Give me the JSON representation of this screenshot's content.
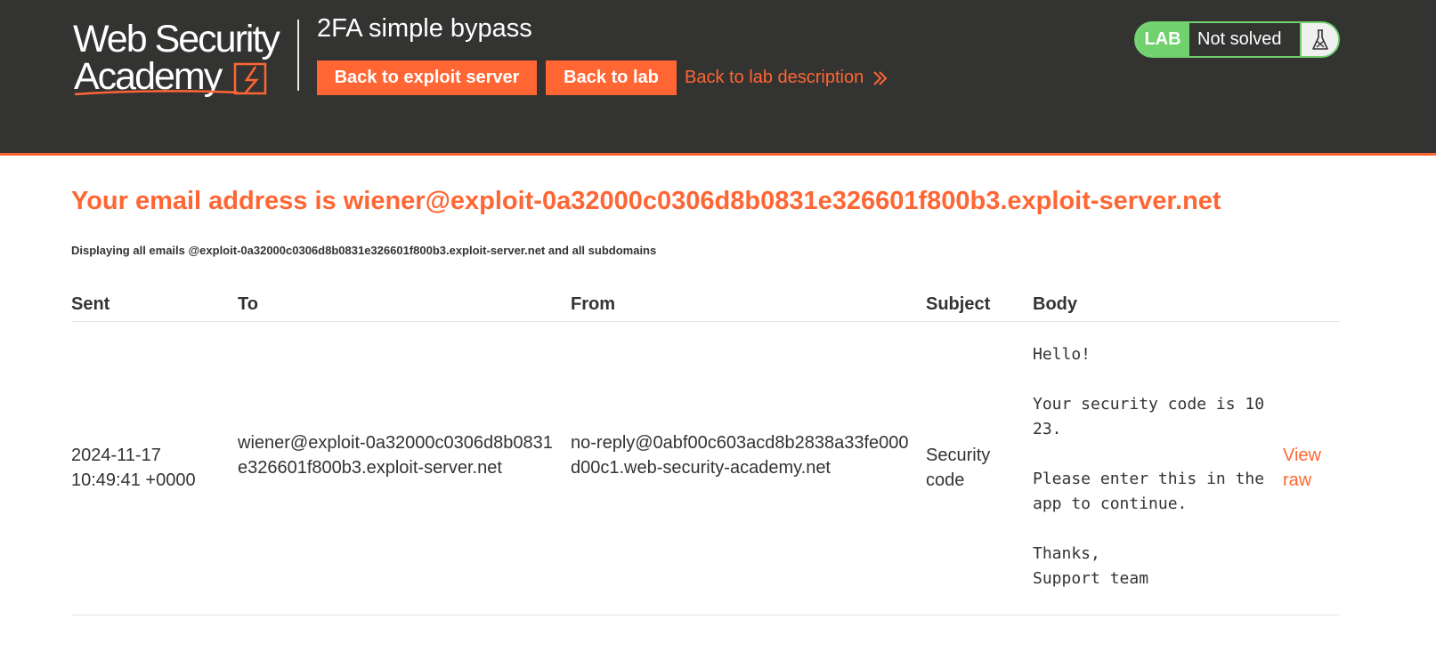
{
  "header": {
    "logo_line1": "Web Security",
    "logo_line2": "Academy",
    "lab_title": "2FA simple bypass",
    "buttons": {
      "exploit_server": "Back to exploit server",
      "lab": "Back to lab"
    },
    "description_link": "Back to lab description",
    "lab_status": {
      "tag": "LAB",
      "state": "Not solved"
    }
  },
  "main": {
    "heading": "Your email address is wiener@exploit-0a32000c0306d8b0831e326601f800b3.exploit-server.net",
    "subheading": "Displaying all emails @exploit-0a32000c0306d8b0831e326601f800b3.exploit-server.net and all subdomains",
    "table": {
      "headers": [
        "Sent",
        "To",
        "From",
        "Subject",
        "Body"
      ],
      "rows": [
        {
          "sent": "2024-11-17 10:49:41 +0000",
          "to": "wiener@exploit-0a32000c0306d8b0831e326601f800b3.exploit-server.net",
          "from": "no-reply@0abf00c603acd8b2838a33fe000d00c1.web-security-academy.net",
          "subject": "Security code",
          "body": "Hello!\n\nYour security code is 1023.\n\nPlease enter this in the app to continue.\n\nThanks,\nSupport team",
          "action": "View raw"
        }
      ]
    }
  },
  "colors": {
    "accent": "#ff6633",
    "header_bg": "#333332",
    "lab_green": "#70d16d",
    "text": "#333332"
  }
}
